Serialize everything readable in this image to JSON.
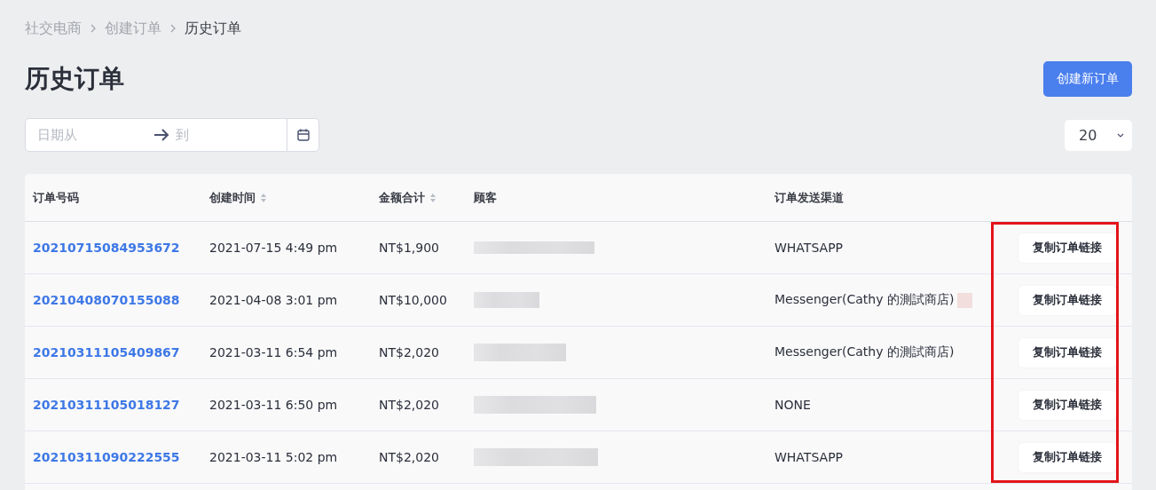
{
  "breadcrumb": [
    {
      "label": "社交电商",
      "current": false
    },
    {
      "label": "创建订单",
      "current": false
    },
    {
      "label": "历史订单",
      "current": true
    }
  ],
  "title": "历史订单",
  "create_button": "创建新订单",
  "date_range": {
    "from_placeholder": "日期从",
    "to_placeholder": "到"
  },
  "page_size": "20",
  "table": {
    "columns": [
      {
        "label": "订单号码",
        "sortable": false
      },
      {
        "label": "创建时间",
        "sortable": true
      },
      {
        "label": "金额合计",
        "sortable": true
      },
      {
        "label": "顾客",
        "sortable": false
      },
      {
        "label": "订单发送渠道",
        "sortable": false
      }
    ],
    "rows": [
      {
        "order": "20210715084953672",
        "created": "2021-07-15 4:49 pm",
        "amount": "NT$1,900",
        "channel": "WHATSAPP",
        "marker": false,
        "action": "复制订单链接"
      },
      {
        "order": "20210408070155088",
        "created": "2021-04-08 3:01 pm",
        "amount": "NT$10,000",
        "channel": "Messenger(Cathy 的測試商店)",
        "marker": true,
        "action": "复制订单链接"
      },
      {
        "order": "20210311105409867",
        "created": "2021-03-11 6:54 pm",
        "amount": "NT$2,020",
        "channel": "Messenger(Cathy 的測試商店)",
        "marker": false,
        "action": "复制订单链接"
      },
      {
        "order": "20210311105018127",
        "created": "2021-03-11 6:50 pm",
        "amount": "NT$2,020",
        "channel": "NONE",
        "marker": false,
        "action": "复制订单链接"
      },
      {
        "order": "20210311090222555",
        "created": "2021-03-11 5:02 pm",
        "amount": "NT$2,020",
        "channel": "WHATSAPP",
        "marker": false,
        "action": "复制订单链接"
      }
    ]
  }
}
